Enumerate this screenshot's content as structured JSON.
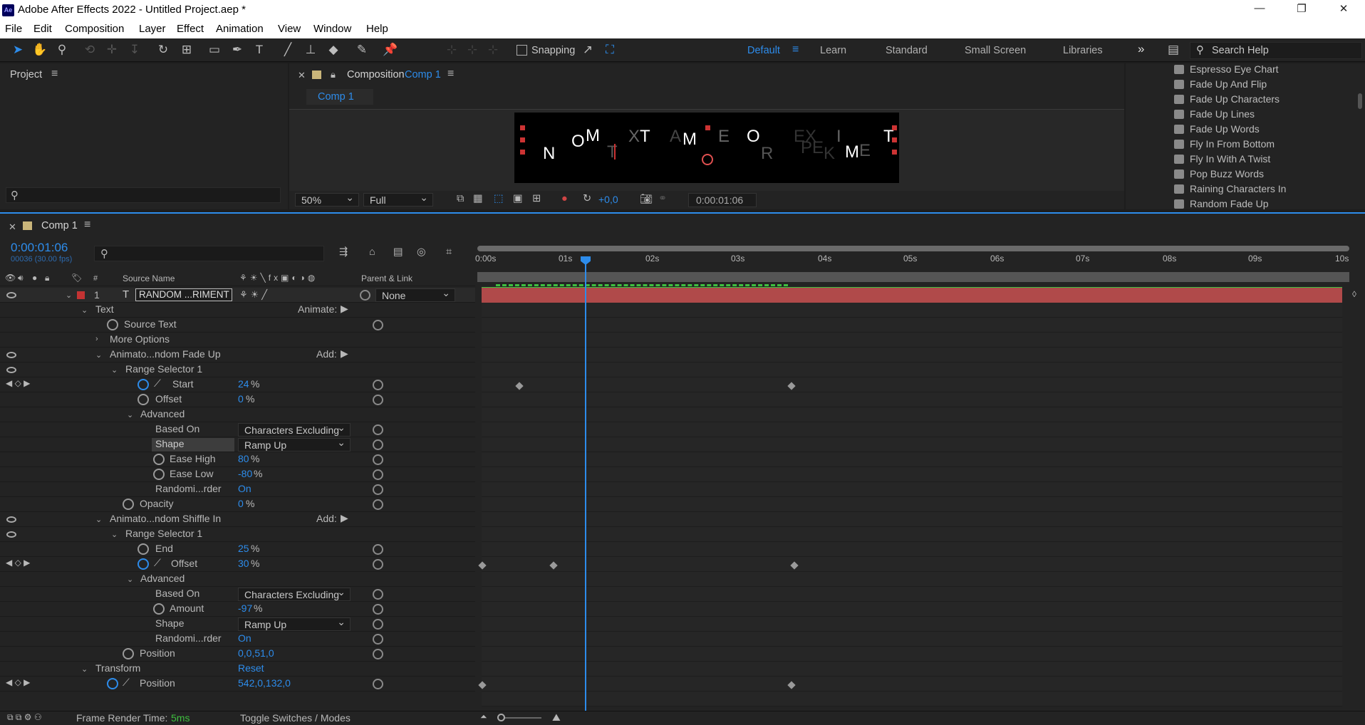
{
  "window": {
    "title": "Adobe After Effects 2022 - Untitled Project.aep *",
    "minimize": "—",
    "maximize": "❐",
    "close": "✕"
  },
  "menu": [
    "File",
    "Edit",
    "Composition",
    "Layer",
    "Effect",
    "Animation",
    "View",
    "Window",
    "Help"
  ],
  "toolbar": {
    "snapping": "Snapping",
    "workspaces": [
      "Default",
      "Learn",
      "Standard",
      "Small Screen",
      "Libraries"
    ],
    "active_workspace": "Default",
    "search_help": "Search Help",
    "more": "»"
  },
  "project": {
    "title": "Project",
    "search_placeholder": ""
  },
  "composition": {
    "panel_label": "Composition",
    "comp_name": "Comp 1",
    "tab": "Comp 1",
    "zoom": "50%",
    "resolution": "Full",
    "exposure": "+0,0",
    "timecode": "0:00:01:06",
    "preview_letters": [
      {
        "t": "N",
        "dim": false
      },
      {
        "t": "O",
        "dim": false
      },
      {
        "t": "M",
        "dim": false
      },
      {
        "t": "T",
        "dim": true
      },
      {
        "t": "X",
        "dim": true
      },
      {
        "t": "T",
        "dim": false
      },
      {
        "t": "A",
        "dim": true
      },
      {
        "t": "M",
        "dim": false
      },
      {
        "t": "E",
        "dim": true
      },
      {
        "t": "O",
        "dim": false
      },
      {
        "t": "R",
        "dim": true
      },
      {
        "t": "E",
        "dim": true
      },
      {
        "t": "X",
        "dim": true
      },
      {
        "t": "P",
        "dim": true
      },
      {
        "t": "E",
        "dim": true
      },
      {
        "t": "K",
        "dim": true
      },
      {
        "t": "I",
        "dim": true
      },
      {
        "t": "M",
        "dim": false
      },
      {
        "t": "E",
        "dim": true
      },
      {
        "t": "T",
        "dim": false
      }
    ]
  },
  "effects": [
    "Espresso Eye Chart",
    "Fade Up And Flip",
    "Fade Up Characters",
    "Fade Up Lines",
    "Fade Up Words",
    "Fly In From Bottom",
    "Fly In With A Twist",
    "Pop Buzz Words",
    "Raining Characters In",
    "Random Fade Up"
  ],
  "timeline": {
    "tab": "Comp 1",
    "timecode": "0:00:01:06",
    "frames": "00036 (30.00 fps)",
    "search_placeholder": "",
    "ruler": [
      "0:00s",
      "01s",
      "02s",
      "03s",
      "04s",
      "05s",
      "06s",
      "07s",
      "08s",
      "09s",
      "10s"
    ],
    "col_source": "Source Name",
    "col_parent": "Parent & Link",
    "layer_index": "1",
    "layer_name": "RANDOM ...RIMENT",
    "parent": "None",
    "frame_render_label": "Frame Render Time:",
    "frame_render_value": "5ms",
    "toggle": "Toggle Switches / Modes"
  },
  "props": {
    "text": "Text",
    "animate": "Animate:",
    "source_text": "Source Text",
    "more_options": "More Options",
    "anim1": "Animato...ndom Fade Up",
    "add": "Add:",
    "range1": "Range Selector 1",
    "start": "Start",
    "start_val": "24",
    "offset": "Offset",
    "offset_val": "0",
    "advanced": "Advanced",
    "based_on": "Based On",
    "based_on_val": "Characters Excluding",
    "shape": "Shape",
    "shape_val": "Ramp Up",
    "ease_high": "Ease High",
    "ease_high_val": "80",
    "ease_low": "Ease Low",
    "ease_low_val": "-80",
    "randomize": "Randomi...rder",
    "randomize_val": "On",
    "opacity": "Opacity",
    "opacity_val": "0",
    "anim2": "Animato...ndom Shiffle In",
    "range2": "Range Selector 1",
    "end": "End",
    "end_val": "25",
    "offset2": "Offset",
    "offset2_val": "30",
    "advanced2": "Advanced",
    "based_on2": "Based On",
    "based_on2_val": "Characters Excluding",
    "amount": "Amount",
    "amount_val": "-97",
    "shape2": "Shape",
    "shape2_val": "Ramp Up",
    "randomize2": "Randomi...rder",
    "randomize2_val": "On",
    "position": "Position",
    "position_val": "0,0,51,0",
    "transform": "Transform",
    "reset": "Reset",
    "tposition": "Position",
    "tposition_val": "542,0,132,0",
    "pct": "%"
  }
}
